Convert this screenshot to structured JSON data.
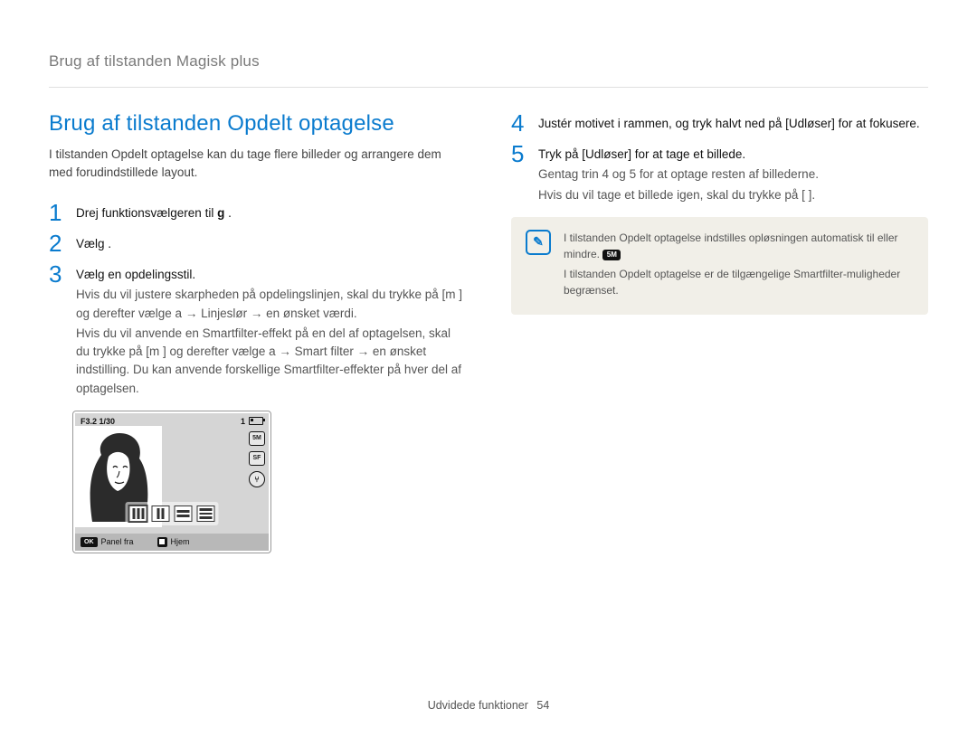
{
  "breadcrumb": "Brug af tilstanden Magisk plus",
  "section_title": "Brug af tilstanden Opdelt optagelse",
  "intro": "I tilstanden Opdelt optagelse kan du tage flere billeder og arrangere dem med forudindstillede layout.",
  "left_steps": [
    {
      "num": "1",
      "primary_pre": "Drej funktionsvælgeren til ",
      "primary_bold": "g",
      "primary_post": " .",
      "subs": []
    },
    {
      "num": "2",
      "primary_pre": "Vælg ",
      "primary_bold": "",
      "primary_post": " .",
      "subs": []
    },
    {
      "num": "3",
      "primary_pre": "Vælg en opdelingsstil.",
      "primary_bold": "",
      "primary_post": "",
      "subs": [
        "Hvis du vil justere skarpheden på opdelingslinjen, skal du trykke på [m   ] og derefter vælge a   → Linjesl‎ør → en ønsket værdi.",
        "Hvis du vil anvende en Smartfilter-effekt på en del af optagelsen, skal du trykke på [m   ] og derefter vælge a   → Smart ﬁlter → en ønsket indstilling. Du kan anvende forskellige Smartfilter-effekter på hver del af optagelsen."
      ]
    }
  ],
  "right_steps": [
    {
      "num": "4",
      "primary": "Justér motivet i rammen, og tryk halvt ned på [Udl‎øser] for at fokusere.",
      "subs": []
    },
    {
      "num": "5",
      "primary": "Tryk på [Udl‎øser] for at tage et billede.",
      "subs": [
        "Gentag trin 4 og 5 for at optage resten af billederne.",
        "Hvis du vil tage et billede igen, skal du trykke på [  ]."
      ]
    }
  ],
  "note": {
    "lines": [
      "I tilstanden Opdelt optagelse indstilles opløsningen automatisk til  eller mindre.",
      "I tilstanden Opdelt optagelse er de tilgængelige Smartfilter-muligheder begrænset."
    ],
    "badge_text": "5M"
  },
  "camera": {
    "top_left": "F3.2  1/30",
    "top_right_num": "1",
    "right_icons": [
      "5M",
      "SF"
    ],
    "bottom_left_chip": "OK",
    "bottom_left_label": "Panel fra",
    "bottom_right_label": "Hjem"
  },
  "footer": {
    "section": "Udvidede funktioner",
    "page": "54"
  }
}
